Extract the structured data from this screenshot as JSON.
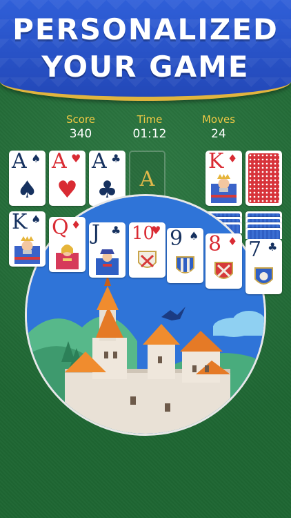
{
  "headline": {
    "line1": "PERSONALIZED",
    "line2": "YOUR GAME"
  },
  "stats": [
    {
      "label": "Score",
      "value": "340"
    },
    {
      "label": "Time",
      "value": "01:12"
    },
    {
      "label": "Moves",
      "value": "24"
    }
  ],
  "foundation": [
    {
      "rank": "A",
      "suit": "♠",
      "color": "black"
    },
    {
      "rank": "A",
      "suit": "♥",
      "color": "red"
    },
    {
      "rank": "A",
      "suit": "♣",
      "color": "black"
    },
    {
      "rank": "A",
      "suit": "",
      "color": "gold"
    }
  ],
  "stock": {
    "rank": "K",
    "suit": "♦",
    "color": "red"
  },
  "tableau": [
    {
      "rank": "K",
      "suit": "♠",
      "color": "black"
    },
    {
      "rank": "Q",
      "suit": "♦",
      "color": "red"
    },
    {
      "rank": "J",
      "suit": "♣",
      "color": "black"
    },
    {
      "rank": "10",
      "suit": "♥",
      "color": "red"
    },
    {
      "rank": "9",
      "suit": "♠",
      "color": "black"
    },
    {
      "rank": "8",
      "suit": "♦",
      "color": "red"
    },
    {
      "rank": "7",
      "suit": "♣",
      "color": "black"
    }
  ],
  "colors": {
    "banner": "#2f5fd8",
    "banner_border": "#e1b43e",
    "felt": "#216f37",
    "stat_label": "#f1c945",
    "card_red": "#d92b33",
    "card_black": "#16315f",
    "sky": "#2f74d8"
  },
  "icons": [
    "spade-icon",
    "heart-icon",
    "club-icon",
    "diamond-icon",
    "castle-illustration",
    "eagle-icon",
    "cloud-icon"
  ]
}
